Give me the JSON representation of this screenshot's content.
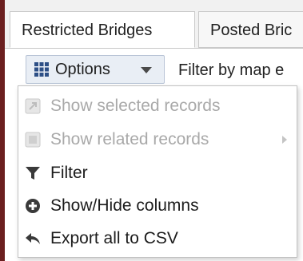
{
  "tabs": [
    {
      "label": "Restricted Bridges",
      "active": true
    },
    {
      "label": "Posted Bric",
      "active": false
    }
  ],
  "toolbar": {
    "options_label": "Options",
    "filter_label": "Filter by map e"
  },
  "menu": {
    "items": [
      {
        "label": "Show selected records",
        "icon": "select-icon",
        "enabled": false
      },
      {
        "label": "Show related records",
        "icon": "related-icon",
        "enabled": false,
        "has_submenu": true
      },
      {
        "label": "Filter",
        "icon": "filter-icon",
        "enabled": true
      },
      {
        "label": "Show/Hide columns",
        "icon": "plus-circle-icon",
        "enabled": true
      },
      {
        "label": "Export all to CSV",
        "icon": "reply-arrow-icon",
        "enabled": true
      }
    ]
  },
  "colors": {
    "window_edge": "#6b1f1f",
    "options_button_bg": "#e9eef5",
    "disabled_text": "#a9a9a9",
    "enabled_text": "#1c1c1c"
  }
}
